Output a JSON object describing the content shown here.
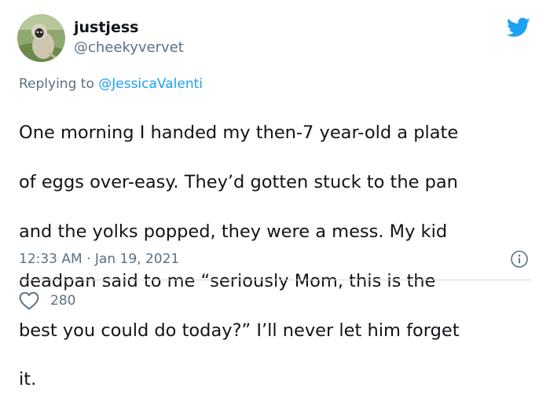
{
  "tweet": {
    "author": {
      "display_name": "justjess",
      "handle": "@cheekyvervet",
      "avatar_icon": "monkey-avatar"
    },
    "reply": {
      "prefix": "Replying to",
      "mention": "@JessicaValenti"
    },
    "body_lines": [
      "One morning I handed my then-7 year-old a plate",
      "of eggs over-easy. They’d gotten stuck to the pan",
      "and the yolks popped, they were a mess. My kid",
      "deadpan said to me “seriously Mom, this is the",
      "best you could do today?” I’ll never let him forget",
      "it."
    ],
    "time": "12:33 AM",
    "separator": "·",
    "date": "Jan 19, 2021",
    "likes": "280",
    "icons": {
      "brand": "twitter-bird-icon",
      "info": "info-icon",
      "like": "heart-icon"
    }
  },
  "colors": {
    "brand_blue": "#1da1f2",
    "text": "#0f1419",
    "secondary": "#5b7083",
    "divider": "#cfd9de"
  }
}
